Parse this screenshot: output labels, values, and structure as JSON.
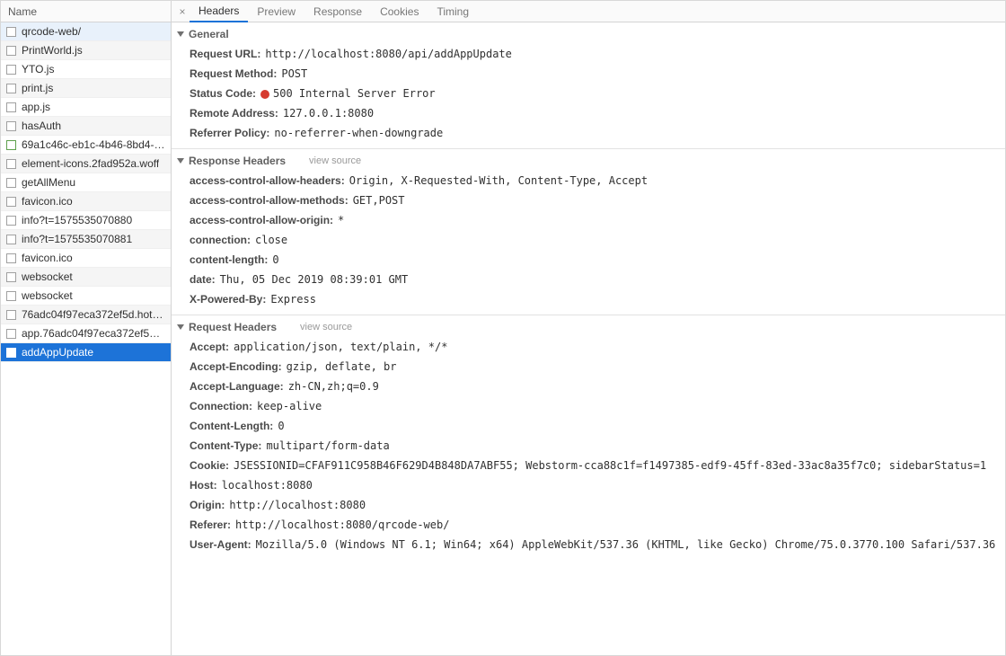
{
  "sidebar": {
    "header": "Name",
    "items": [
      {
        "label": "qrcode-web/"
      },
      {
        "label": "PrintWorld.js"
      },
      {
        "label": "YTO.js"
      },
      {
        "label": "print.js"
      },
      {
        "label": "app.js"
      },
      {
        "label": "hasAuth"
      },
      {
        "label": "69a1c46c-eb1c-4b46-8bd4-…"
      },
      {
        "label": "element-icons.2fad952a.woff"
      },
      {
        "label": "getAllMenu"
      },
      {
        "label": "favicon.ico"
      },
      {
        "label": "info?t=1575535070880"
      },
      {
        "label": "info?t=1575535070881"
      },
      {
        "label": "favicon.ico"
      },
      {
        "label": "websocket"
      },
      {
        "label": "websocket"
      },
      {
        "label": "76adc04f97eca372ef5d.hot-…"
      },
      {
        "label": "app.76adc04f97eca372ef5d.…"
      },
      {
        "label": "addAppUpdate"
      }
    ],
    "selected_index": 17
  },
  "tabs": {
    "close_glyph": "×",
    "items": [
      {
        "label": "Headers"
      },
      {
        "label": "Preview"
      },
      {
        "label": "Response"
      },
      {
        "label": "Cookies"
      },
      {
        "label": "Timing"
      }
    ],
    "active_index": 0
  },
  "sections": {
    "general": {
      "title": "General",
      "items": [
        {
          "k": "Request URL:",
          "v": "http://localhost:8080/api/addAppUpdate"
        },
        {
          "k": "Request Method:",
          "v": "POST"
        },
        {
          "k": "Status Code:",
          "v": "500 Internal Server Error",
          "status": true
        },
        {
          "k": "Remote Address:",
          "v": "127.0.0.1:8080"
        },
        {
          "k": "Referrer Policy:",
          "v": "no-referrer-when-downgrade"
        }
      ]
    },
    "response_headers": {
      "title": "Response Headers",
      "view_source": "view source",
      "items": [
        {
          "k": "access-control-allow-headers:",
          "v": "Origin, X-Requested-With, Content-Type, Accept"
        },
        {
          "k": "access-control-allow-methods:",
          "v": "GET,POST"
        },
        {
          "k": "access-control-allow-origin:",
          "v": "*"
        },
        {
          "k": "connection:",
          "v": "close"
        },
        {
          "k": "content-length:",
          "v": "0"
        },
        {
          "k": "date:",
          "v": "Thu, 05 Dec 2019 08:39:01 GMT"
        },
        {
          "k": "X-Powered-By:",
          "v": "Express"
        }
      ]
    },
    "request_headers": {
      "title": "Request Headers",
      "view_source": "view source",
      "items": [
        {
          "k": "Accept:",
          "v": "application/json, text/plain, */*"
        },
        {
          "k": "Accept-Encoding:",
          "v": "gzip, deflate, br"
        },
        {
          "k": "Accept-Language:",
          "v": "zh-CN,zh;q=0.9"
        },
        {
          "k": "Connection:",
          "v": "keep-alive"
        },
        {
          "k": "Content-Length:",
          "v": "0"
        },
        {
          "k": "Content-Type:",
          "v": "multipart/form-data"
        },
        {
          "k": "Cookie:",
          "v": "JSESSIONID=CFAF911C958B46F629D4B848DA7ABF55; Webstorm-cca88c1f=f1497385-edf9-45ff-83ed-33ac8a35f7c0; sidebarStatus=1"
        },
        {
          "k": "Host:",
          "v": "localhost:8080"
        },
        {
          "k": "Origin:",
          "v": "http://localhost:8080"
        },
        {
          "k": "Referer:",
          "v": "http://localhost:8080/qrcode-web/"
        },
        {
          "k": "User-Agent:",
          "v": "Mozilla/5.0 (Windows NT 6.1; Win64; x64) AppleWebKit/537.36 (KHTML, like Gecko) Chrome/75.0.3770.100 Safari/537.36"
        }
      ]
    }
  }
}
